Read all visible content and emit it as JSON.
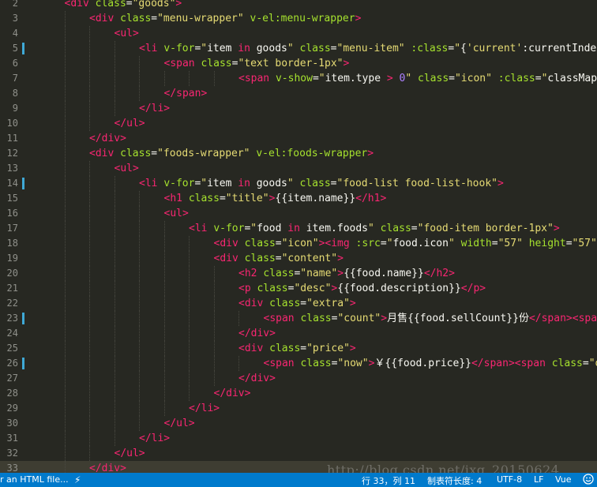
{
  "editor": {
    "lines": [
      {
        "n": "2",
        "mod": false,
        "indent": 1,
        "tokens": [
          [
            "t",
            "<div "
          ],
          [
            "a",
            "class"
          ],
          [
            "p",
            "="
          ],
          [
            "s",
            "\"goods\""
          ],
          [
            "t",
            ">"
          ]
        ]
      },
      {
        "n": "3",
        "mod": false,
        "indent": 2,
        "tokens": [
          [
            "t",
            "<div "
          ],
          [
            "a",
            "class"
          ],
          [
            "p",
            "="
          ],
          [
            "s",
            "\"menu-wrapper\""
          ],
          [
            "a",
            " v-el:menu-wrapper"
          ],
          [
            "t",
            ">"
          ]
        ]
      },
      {
        "n": "4",
        "mod": false,
        "indent": 3,
        "tokens": [
          [
            "t",
            "<ul>"
          ]
        ]
      },
      {
        "n": "5",
        "mod": true,
        "indent": 4,
        "tokens": [
          [
            "t",
            "<li "
          ],
          [
            "a",
            "v-for"
          ],
          [
            "p",
            "="
          ],
          [
            "s",
            "\""
          ],
          [
            "p",
            "item "
          ],
          [
            "t",
            "in"
          ],
          [
            "p",
            " goods"
          ],
          [
            "s",
            "\""
          ],
          [
            "a",
            " class"
          ],
          [
            "p",
            "="
          ],
          [
            "s",
            "\"menu-item\""
          ],
          [
            "a",
            " :class"
          ],
          [
            "p",
            "="
          ],
          [
            "s",
            "\""
          ],
          [
            "p",
            "{"
          ],
          [
            "s",
            "'current'"
          ],
          [
            "p",
            ":currentIndex"
          ]
        ]
      },
      {
        "n": "6",
        "mod": false,
        "indent": 5,
        "tokens": [
          [
            "t",
            "<span "
          ],
          [
            "a",
            "class"
          ],
          [
            "p",
            "="
          ],
          [
            "s",
            "\"text border-1px\""
          ],
          [
            "t",
            ">"
          ]
        ]
      },
      {
        "n": "7",
        "mod": false,
        "indent": 8,
        "tokens": [
          [
            "t",
            "<span "
          ],
          [
            "a",
            "v-show"
          ],
          [
            "p",
            "="
          ],
          [
            "s",
            "\""
          ],
          [
            "p",
            "item.type "
          ],
          [
            "t",
            ">"
          ],
          [
            "p",
            " "
          ],
          [
            "n",
            "0"
          ],
          [
            "s",
            "\""
          ],
          [
            "a",
            " class"
          ],
          [
            "p",
            "="
          ],
          [
            "s",
            "\"icon\""
          ],
          [
            "a",
            " :class"
          ],
          [
            "p",
            "="
          ],
          [
            "s",
            "\""
          ],
          [
            "p",
            "classMap[i"
          ]
        ]
      },
      {
        "n": "8",
        "mod": false,
        "indent": 5,
        "tokens": [
          [
            "t",
            "</span>"
          ]
        ]
      },
      {
        "n": "9",
        "mod": false,
        "indent": 4,
        "tokens": [
          [
            "t",
            "</li>"
          ]
        ]
      },
      {
        "n": "10",
        "mod": false,
        "indent": 3,
        "tokens": [
          [
            "t",
            "</ul>"
          ]
        ]
      },
      {
        "n": "11",
        "mod": false,
        "indent": 2,
        "tokens": [
          [
            "t",
            "</div>"
          ]
        ]
      },
      {
        "n": "12",
        "mod": false,
        "indent": 2,
        "tokens": [
          [
            "t",
            "<div "
          ],
          [
            "a",
            "class"
          ],
          [
            "p",
            "="
          ],
          [
            "s",
            "\"foods-wrapper\""
          ],
          [
            "a",
            " v-el:foods-wrapper"
          ],
          [
            "t",
            ">"
          ]
        ]
      },
      {
        "n": "13",
        "mod": false,
        "indent": 3,
        "tokens": [
          [
            "t",
            "<ul>"
          ]
        ]
      },
      {
        "n": "14",
        "mod": true,
        "indent": 4,
        "tokens": [
          [
            "t",
            "<li "
          ],
          [
            "a",
            "v-for"
          ],
          [
            "p",
            "="
          ],
          [
            "s",
            "\""
          ],
          [
            "p",
            "item "
          ],
          [
            "t",
            "in"
          ],
          [
            "p",
            " goods"
          ],
          [
            "s",
            "\""
          ],
          [
            "a",
            " class"
          ],
          [
            "p",
            "="
          ],
          [
            "s",
            "\"food-list food-list-hook\""
          ],
          [
            "t",
            ">"
          ]
        ]
      },
      {
        "n": "15",
        "mod": false,
        "indent": 5,
        "tokens": [
          [
            "t",
            "<h1 "
          ],
          [
            "a",
            "class"
          ],
          [
            "p",
            "="
          ],
          [
            "s",
            "\"title\""
          ],
          [
            "t",
            ">"
          ],
          [
            "p",
            "{{item.name}}"
          ],
          [
            "t",
            "</h1>"
          ]
        ]
      },
      {
        "n": "16",
        "mod": false,
        "indent": 5,
        "tokens": [
          [
            "t",
            "<ul>"
          ]
        ]
      },
      {
        "n": "17",
        "mod": false,
        "indent": 6,
        "tokens": [
          [
            "t",
            "<li "
          ],
          [
            "a",
            "v-for"
          ],
          [
            "p",
            "="
          ],
          [
            "s",
            "\""
          ],
          [
            "p",
            "food "
          ],
          [
            "t",
            "in"
          ],
          [
            "p",
            " item.foods"
          ],
          [
            "s",
            "\""
          ],
          [
            "a",
            " class"
          ],
          [
            "p",
            "="
          ],
          [
            "s",
            "\"food-item border-1px\""
          ],
          [
            "t",
            ">"
          ]
        ]
      },
      {
        "n": "18",
        "mod": false,
        "indent": 7,
        "tokens": [
          [
            "t",
            "<div "
          ],
          [
            "a",
            "class"
          ],
          [
            "p",
            "="
          ],
          [
            "s",
            "\"icon\""
          ],
          [
            "t",
            ">"
          ],
          [
            "t",
            "<img "
          ],
          [
            "a",
            ":src"
          ],
          [
            "p",
            "="
          ],
          [
            "s",
            "\""
          ],
          [
            "p",
            "food.icon"
          ],
          [
            "s",
            "\""
          ],
          [
            "a",
            " width"
          ],
          [
            "p",
            "="
          ],
          [
            "s",
            "\"57\""
          ],
          [
            "a",
            " height"
          ],
          [
            "p",
            "="
          ],
          [
            "s",
            "\"57\""
          ],
          [
            "t",
            ">"
          ],
          [
            "t",
            "<"
          ]
        ]
      },
      {
        "n": "19",
        "mod": false,
        "indent": 7,
        "tokens": [
          [
            "t",
            "<div "
          ],
          [
            "a",
            "class"
          ],
          [
            "p",
            "="
          ],
          [
            "s",
            "\"content\""
          ],
          [
            "t",
            ">"
          ]
        ]
      },
      {
        "n": "20",
        "mod": false,
        "indent": 8,
        "tokens": [
          [
            "t",
            "<h2 "
          ],
          [
            "a",
            "class"
          ],
          [
            "p",
            "="
          ],
          [
            "s",
            "\"name\""
          ],
          [
            "t",
            ">"
          ],
          [
            "p",
            "{{food.name}}"
          ],
          [
            "t",
            "</h2>"
          ]
        ]
      },
      {
        "n": "21",
        "mod": false,
        "indent": 8,
        "tokens": [
          [
            "t",
            "<p "
          ],
          [
            "a",
            "class"
          ],
          [
            "p",
            "="
          ],
          [
            "s",
            "\"desc\""
          ],
          [
            "t",
            ">"
          ],
          [
            "p",
            "{{food.description}}"
          ],
          [
            "t",
            "</p>"
          ]
        ]
      },
      {
        "n": "22",
        "mod": false,
        "indent": 8,
        "tokens": [
          [
            "t",
            "<div "
          ],
          [
            "a",
            "class"
          ],
          [
            "p",
            "="
          ],
          [
            "s",
            "\"extra\""
          ],
          [
            "t",
            ">"
          ]
        ]
      },
      {
        "n": "23",
        "mod": true,
        "indent": 9,
        "tokens": [
          [
            "t",
            "<span "
          ],
          [
            "a",
            "class"
          ],
          [
            "p",
            "="
          ],
          [
            "s",
            "\"count\""
          ],
          [
            "t",
            ">"
          ],
          [
            "p",
            "月售{{food.sellCount}}份"
          ],
          [
            "t",
            "</span>"
          ],
          [
            "t",
            "<span>"
          ]
        ]
      },
      {
        "n": "24",
        "mod": false,
        "indent": 8,
        "tokens": [
          [
            "t",
            "</div>"
          ]
        ]
      },
      {
        "n": "25",
        "mod": false,
        "indent": 8,
        "tokens": [
          [
            "t",
            "<div "
          ],
          [
            "a",
            "class"
          ],
          [
            "p",
            "="
          ],
          [
            "s",
            "\"price\""
          ],
          [
            "t",
            ">"
          ]
        ]
      },
      {
        "n": "26",
        "mod": true,
        "indent": 9,
        "tokens": [
          [
            "t",
            "<span "
          ],
          [
            "a",
            "class"
          ],
          [
            "p",
            "="
          ],
          [
            "s",
            "\"now\""
          ],
          [
            "t",
            ">"
          ],
          [
            "p",
            "￥{{food.price}}"
          ],
          [
            "t",
            "</span>"
          ],
          [
            "t",
            "<span "
          ],
          [
            "a",
            "class"
          ],
          [
            "p",
            "="
          ],
          [
            "s",
            "\"ol"
          ]
        ]
      },
      {
        "n": "27",
        "mod": false,
        "indent": 8,
        "tokens": [
          [
            "t",
            "</div>"
          ]
        ]
      },
      {
        "n": "28",
        "mod": false,
        "indent": 7,
        "tokens": [
          [
            "t",
            "</div>"
          ]
        ]
      },
      {
        "n": "29",
        "mod": false,
        "indent": 6,
        "tokens": [
          [
            "t",
            "</li>"
          ]
        ]
      },
      {
        "n": "30",
        "mod": false,
        "indent": 5,
        "tokens": [
          [
            "t",
            "</ul>"
          ]
        ]
      },
      {
        "n": "31",
        "mod": false,
        "indent": 4,
        "tokens": [
          [
            "t",
            "</li>"
          ]
        ]
      },
      {
        "n": "32",
        "mod": false,
        "indent": 3,
        "tokens": [
          [
            "t",
            "</ul>"
          ]
        ]
      },
      {
        "n": "33",
        "mod": false,
        "indent": 2,
        "current": true,
        "tokens": [
          [
            "t",
            "</div>"
          ]
        ]
      }
    ]
  },
  "watermark": "http://blog.csdn.net/jxg_20150624",
  "statusbar": {
    "left_text": "r an HTML file...",
    "bolt_icon": "lightning-icon",
    "position": "行 33，列 11",
    "tab_size": "制表符长度: 4",
    "encoding": "UTF-8",
    "line_ending": "LF",
    "language": "Vue",
    "feedback_icon": "smiley-icon"
  },
  "colors": {
    "background": "#272822",
    "status_bar": "#007acc",
    "tag": "#f92672",
    "attribute": "#a6e22e",
    "string": "#e6db74",
    "number": "#ae81ff"
  }
}
